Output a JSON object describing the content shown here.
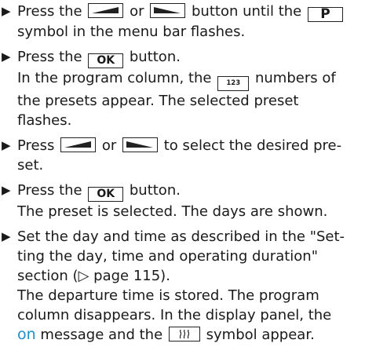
{
  "bullet_glyph": "▶",
  "steps": [
    {
      "l1_a": "Press the",
      "l1_b": "or",
      "l1_c": "button until the",
      "key_p": "P",
      "l2": "symbol in the menu bar flashes."
    },
    {
      "l1_a": "Press the",
      "key_ok": "OK",
      "l1_b": "button.",
      "l2_a": "In the program column, the",
      "key_123": "123",
      "l2_b": "numbers of",
      "l3": "the presets appear. The selected preset",
      "l4": "flashes."
    },
    {
      "l1_a": "Press",
      "l1_b": "or",
      "l1_c": "to select the desired pre-",
      "l2": "set."
    },
    {
      "l1_a": "Press the",
      "key_ok": "OK",
      "l1_b": "button.",
      "l2": "The preset is selected. The days are shown."
    },
    {
      "l1": "Set the day and time as described in the \"Set-",
      "l2": "ting the day, time and operating duration\"",
      "l3": "section (▷ page 115).",
      "l4": "The departure time is stored. The program",
      "l5": "column disappears. In the display panel, the",
      "on_msg": "on",
      "l6_a": "message and the",
      "l6_b": "symbol appear."
    }
  ],
  "icons": {
    "left_button": "left-arrow-key-icon",
    "right_button": "right-arrow-key-icon",
    "heater_symbol": "heater-symbol-icon"
  },
  "colors": {
    "text": "#1a1a1a",
    "on_message": "#1f8fc9"
  }
}
